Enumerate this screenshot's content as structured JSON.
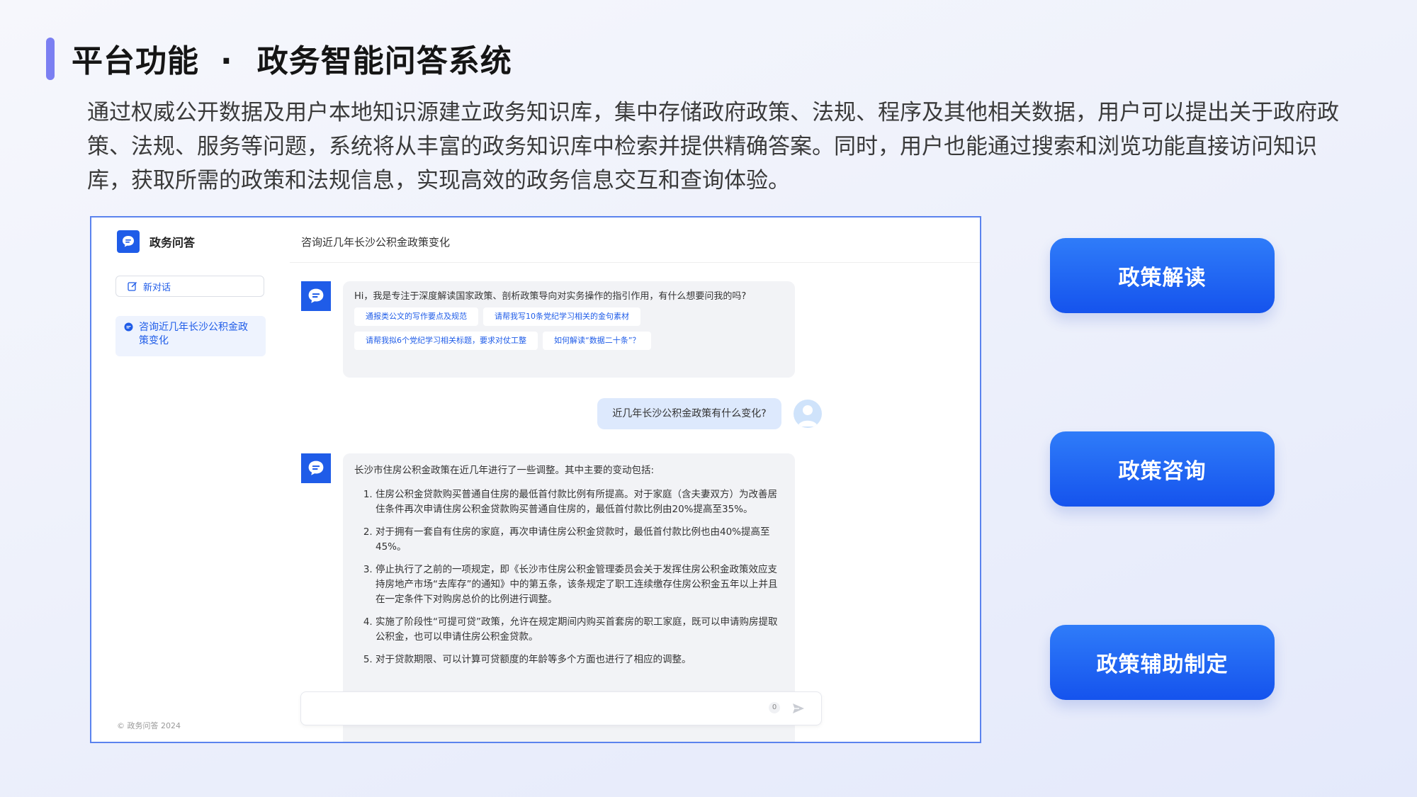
{
  "header": {
    "title_left": "平台功能",
    "title_sep": "·",
    "title_right": "政务智能问答系统",
    "intro": "通过权威公开数据及用户本地知识源建立政务知识库，集中存储政府政策、法规、程序及其他相关数据，用户可以提出关于政府政策、法规、服务等问题，系统将从丰富的政务知识库中检索并提供精确答案。同时，用户也能通过搜索和浏览功能直接访问知识库，获取所需的政策和法规信息，实现高效的政务信息交互和查询体验。"
  },
  "app": {
    "brand": "政务问答",
    "new_chat": "新对话",
    "conversations": [
      "咨询近几年长沙公积金政策变化"
    ],
    "footer": "© 政务问答 2024",
    "chat_title": "咨询近几年长沙公积金政策变化",
    "bot_greeting": "Hi，我是专注于深度解读国家政策、剖析政策导向对实务操作的指引作用，有什么想要问我的吗?",
    "suggestions": [
      "通报类公文的写作要点及规范",
      "请帮我写10条党纪学习相关的金句素材",
      "请帮我拟6个党纪学习相关标题，要求对仗工整",
      "如何解读“数据二十条”？"
    ],
    "user_question": "近几年长沙公积金政策有什么变化?",
    "answer_lead": "长沙市住房公积金政策在近几年进行了一些调整。其中主要的变动包括:",
    "answer_items": [
      "住房公积金贷款购买普通自住房的最低首付款比例有所提高。对于家庭（含夫妻双方）为改善居住条件再次申请住房公积金贷款购买普通自住房的，最低首付款比例由20%提高至35%。",
      "对于拥有一套自有住房的家庭，再次申请住房公积金贷款时，最低首付款比例也由40%提高至45%。",
      "停止执行了之前的一项规定，即《长沙市住房公积金管理委员会关于发挥住房公积金政策效应支持房地产市场“去库存”的通知》中的第五条，该条规定了职工连续缴存住房公积金五年以上并且在一定条件下对购房总价的比例进行调整。",
      "实施了阶段性“可提可贷”政策，允许在规定期间内购买首套房的职工家庭，既可以申请购房提取公积金，也可以申请住房公积金贷款。",
      "对于贷款期限、可以计算可贷额度的年龄等多个方面也进行了相应的调整。"
    ],
    "input_counter": "0"
  },
  "features": [
    "政策解读",
    "政策咨询",
    "政策辅助制定"
  ],
  "colors": {
    "accent": "#7b7ff2",
    "primary": "#1f5ce8",
    "button_top": "#2f7cf9",
    "button_bottom": "#1553ed"
  }
}
